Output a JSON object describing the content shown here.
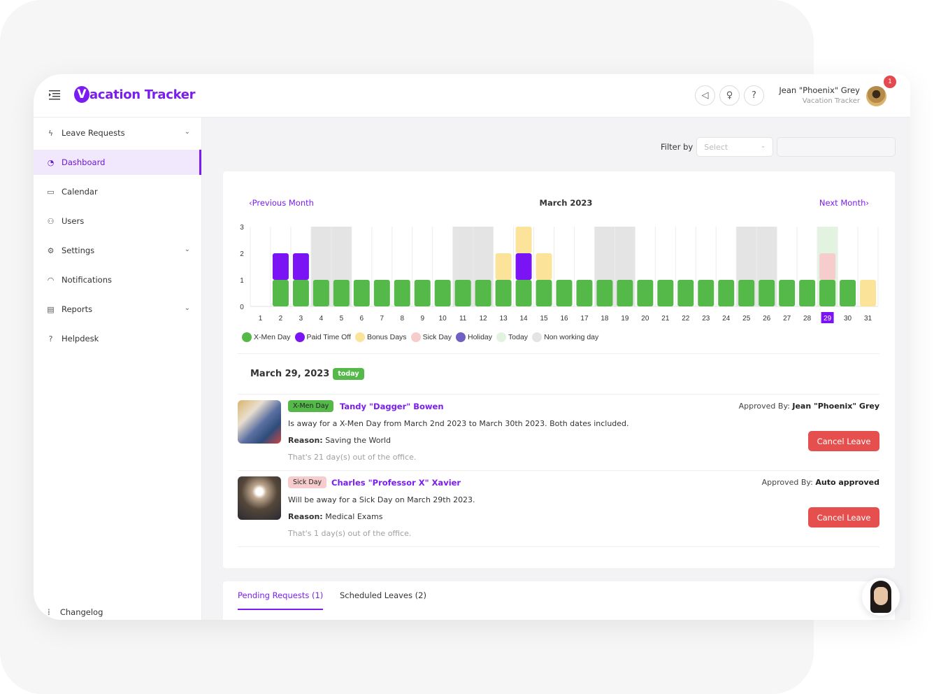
{
  "app": {
    "title": "Vacation Tracker",
    "logo_letter": "V",
    "logo_rest": "acation Tracker"
  },
  "header": {
    "icons": [
      "megaphone-icon",
      "lightbulb-icon",
      "help-icon"
    ],
    "icon_glyphs": [
      "◁",
      "♀",
      "?"
    ],
    "user_name": "Jean \"Phoenix\" Grey",
    "user_org": "Vacation Tracker",
    "notification_count": "1"
  },
  "sidebar": {
    "items": [
      {
        "label": "Leave Requests",
        "icon": "lightning-icon",
        "glyph": "ϟ",
        "has_submenu": true
      },
      {
        "label": "Dashboard",
        "icon": "dashboard-icon",
        "glyph": "◔",
        "active": true
      },
      {
        "label": "Calendar",
        "icon": "calendar-icon",
        "glyph": "▭"
      },
      {
        "label": "Users",
        "icon": "user-icon",
        "glyph": "⚇"
      },
      {
        "label": "Settings",
        "icon": "gear-icon",
        "glyph": "⚙",
        "has_submenu": true
      },
      {
        "label": "Notifications",
        "icon": "bell-icon",
        "glyph": "◠"
      },
      {
        "label": "Reports",
        "icon": "report-icon",
        "glyph": "▤",
        "has_submenu": true
      },
      {
        "label": "Helpdesk",
        "icon": "help-circle-icon",
        "glyph": "?"
      }
    ],
    "changelog": "Changelog"
  },
  "filter": {
    "label": "Filter by",
    "select_placeholder": "Select",
    "search_value": ""
  },
  "calendar": {
    "prev_label": "Previous Month",
    "next_label": "Next Month",
    "month_title": "March 2023"
  },
  "chart_data": {
    "type": "bar",
    "stacked": true,
    "title": "March 2023",
    "xlabel": "",
    "ylabel": "",
    "ylim": [
      0,
      3
    ],
    "yticks": [
      0,
      1,
      2,
      3
    ],
    "categories": [
      "1",
      "2",
      "3",
      "4",
      "5",
      "6",
      "7",
      "8",
      "9",
      "10",
      "11",
      "12",
      "13",
      "14",
      "15",
      "16",
      "17",
      "18",
      "19",
      "20",
      "21",
      "22",
      "23",
      "24",
      "25",
      "26",
      "27",
      "28",
      "29",
      "30",
      "31"
    ],
    "highlighted_category": "29",
    "non_working_days": [
      "4",
      "5",
      "11",
      "12",
      "18",
      "19",
      "25",
      "26"
    ],
    "today": "29",
    "series": [
      {
        "name": "X-Men Day",
        "color": "#54b948",
        "values": [
          0,
          1,
          1,
          1,
          1,
          1,
          1,
          1,
          1,
          1,
          1,
          1,
          1,
          1,
          1,
          1,
          1,
          1,
          1,
          1,
          1,
          1,
          1,
          1,
          1,
          1,
          1,
          1,
          1,
          1,
          0
        ]
      },
      {
        "name": "Paid Time Off",
        "color": "#7a14f5",
        "values": [
          0,
          1,
          1,
          0,
          0,
          0,
          0,
          0,
          0,
          0,
          0,
          0,
          0,
          1,
          0,
          0,
          0,
          0,
          0,
          0,
          0,
          0,
          0,
          0,
          0,
          0,
          0,
          0,
          0,
          0,
          0
        ]
      },
      {
        "name": "Bonus Days",
        "color": "#fbe39a",
        "values": [
          0,
          0,
          0,
          0,
          0,
          0,
          0,
          0,
          0,
          0,
          0,
          0,
          1,
          1,
          1,
          0,
          0,
          0,
          0,
          0,
          0,
          0,
          0,
          0,
          0,
          0,
          0,
          0,
          0,
          0,
          1
        ]
      },
      {
        "name": "Sick Day",
        "color": "#f7cccc",
        "values": [
          0,
          0,
          0,
          0,
          0,
          0,
          0,
          0,
          0,
          0,
          0,
          0,
          0,
          0,
          0,
          0,
          0,
          0,
          0,
          0,
          0,
          0,
          0,
          0,
          0,
          0,
          0,
          0,
          1,
          0,
          0
        ]
      },
      {
        "name": "Holiday",
        "color": "#7160c4",
        "values": [
          0,
          0,
          0,
          0,
          0,
          0,
          0,
          0,
          0,
          0,
          0,
          0,
          0,
          0,
          0,
          0,
          0,
          0,
          0,
          0,
          0,
          0,
          0,
          0,
          0,
          0,
          0,
          0,
          0,
          0,
          0
        ]
      }
    ],
    "legend": [
      {
        "name": "X-Men Day",
        "color": "#54b948"
      },
      {
        "name": "Paid Time Off",
        "color": "#7a14f5"
      },
      {
        "name": "Bonus Days",
        "color": "#fbe39a"
      },
      {
        "name": "Sick Day",
        "color": "#f7cccc"
      },
      {
        "name": "Holiday",
        "color": "#7160c4"
      },
      {
        "name": "Today",
        "color": "#e2f4e0"
      },
      {
        "name": "Non working day",
        "color": "#e4e4e4"
      }
    ],
    "legend_position": "bottom-left",
    "grid": true
  },
  "day_view": {
    "date": "March 29, 2023",
    "today_tag": "today",
    "entries": [
      {
        "type": "X-Men Day",
        "name": "Tandy \"Dagger\" Bowen",
        "description": "Is away for a X-Men Day from March 2nd 2023 to March 30th 2023. Both dates included.",
        "reason_label": "Reason:",
        "reason": "Saving the World",
        "duration": "That's 21 day(s) out of the office.",
        "approved_label": "Approved By:",
        "approved_by": "Jean \"Phoenix\" Grey",
        "action": "Cancel Leave"
      },
      {
        "type": "Sick Day",
        "name": "Charles \"Professor X\" Xavier",
        "description": "Will be away for a Sick Day on March 29th 2023.",
        "reason_label": "Reason:",
        "reason": "Medical Exams",
        "duration": "That's 1 day(s) out of the office.",
        "approved_label": "Approved By:",
        "approved_by": "Auto approved",
        "action": "Cancel Leave"
      }
    ]
  },
  "bottom_tabs": [
    {
      "label": "Pending Requests (1)",
      "active": true
    },
    {
      "label": "Scheduled Leaves (2)",
      "active": false
    }
  ]
}
